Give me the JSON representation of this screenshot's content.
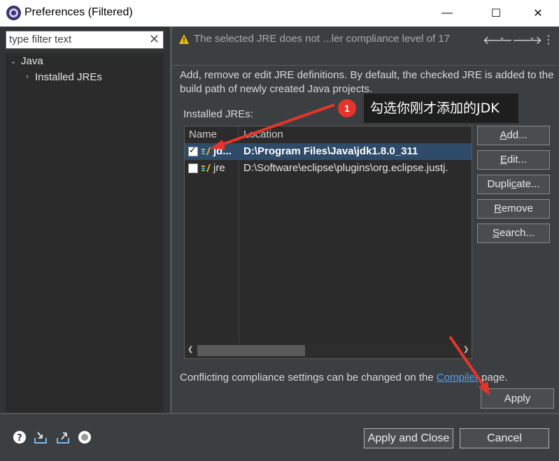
{
  "window": {
    "title": "Preferences (Filtered)",
    "minimize": "—",
    "maximize": "☐",
    "close": "✕"
  },
  "filter": {
    "value": "type filter text",
    "clear": "✕"
  },
  "tree": [
    {
      "label": "Java",
      "chevron": "⌄"
    },
    {
      "label": "Installed JREs",
      "chevron": "›"
    }
  ],
  "message": {
    "text": "The selected JRE does not ...ler compliance level of 17",
    "back": "🡐",
    "forward": "🡒",
    "dropdown": "▼",
    "menu": "⋮"
  },
  "page": {
    "description": "Add, remove or edit JRE definitions. By default, the checked JRE is added to the build path of newly created Java projects.",
    "installed_label": "Installed JREs:",
    "conflict_prefix": "Conflicting compliance settings can be changed on the ",
    "conflict_link": "Compiler",
    "conflict_suffix": " page.",
    "apply_label": "Apply"
  },
  "table": {
    "columns": [
      "Name",
      "Location"
    ],
    "rows": [
      {
        "checked": true,
        "name": "jd...",
        "location": "D:\\Program Files\\Java\\jdk1.8.0_311",
        "selected": true
      },
      {
        "checked": false,
        "name": "jre",
        "location": "D:\\Software\\eclipse\\plugins\\org.eclipse.justj.",
        "selected": false
      }
    ]
  },
  "buttons": {
    "add": {
      "m": "A",
      "rest": "dd..."
    },
    "edit": {
      "m": "E",
      "rest": "dit..."
    },
    "duplicate": {
      "pre": "Dupli",
      "m": "c",
      "rest": "ate..."
    },
    "remove": {
      "m": "R",
      "rest": "emove"
    },
    "search": {
      "m": "S",
      "rest": "earch..."
    }
  },
  "footer": {
    "apply_close": "Apply and Close",
    "cancel": "Cancel"
  },
  "annotation": {
    "badge": "1",
    "text": "勾选你刚才添加的JDK",
    "color": "#e5352b"
  },
  "colors": {
    "background": "#3c3f41",
    "link": "#4aa3ff",
    "selection": "#2f4b6a",
    "warning": "#f0c000"
  }
}
